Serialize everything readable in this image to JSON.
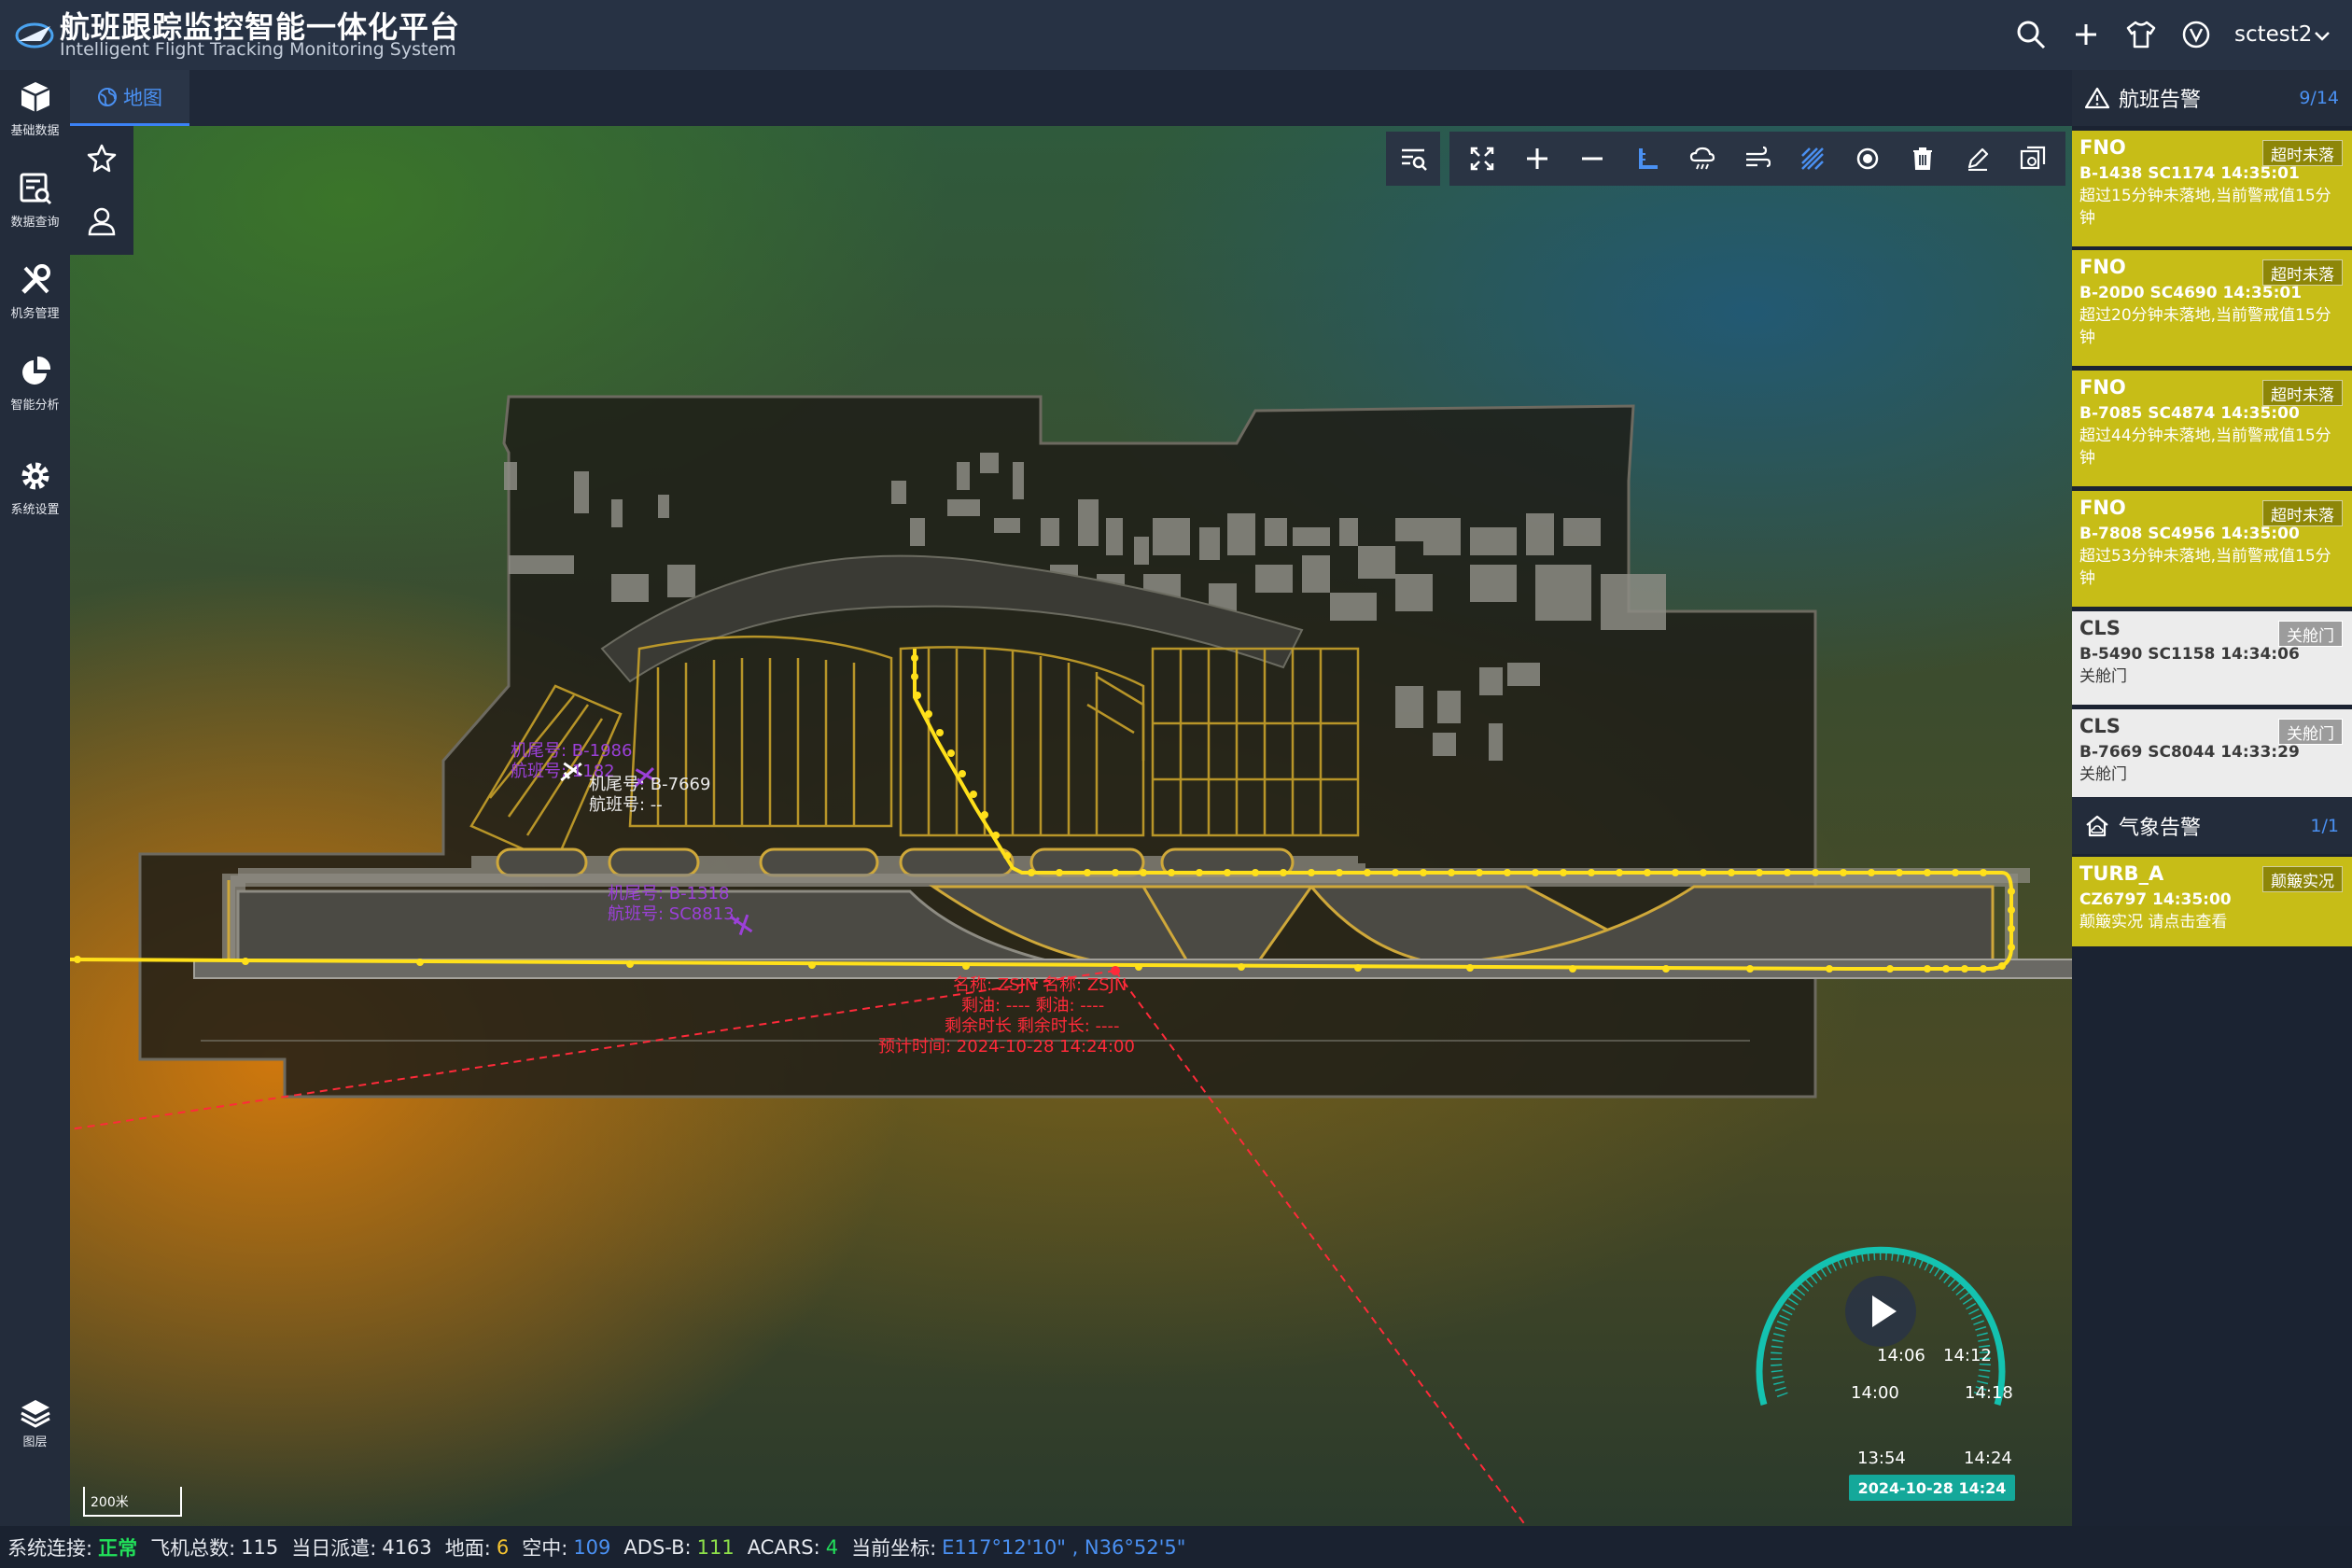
{
  "app": {
    "title": "航班跟踪监控智能一体化平台",
    "subtitle": "Intelligent Flight Tracking Monitoring System",
    "user": "sctest2"
  },
  "header_icons": [
    "search-icon",
    "plus-icon",
    "shirt-icon",
    "v-circle-icon",
    "chevron-down-icon"
  ],
  "nav": [
    {
      "label": "基础数据",
      "icon": "cube-icon"
    },
    {
      "label": "数据查询",
      "icon": "data-query-icon"
    },
    {
      "label": "机务管理",
      "icon": "tools-icon"
    },
    {
      "label": "智能分析",
      "icon": "pie-chart-icon"
    },
    {
      "label": "系统设置",
      "icon": "gear-icon"
    }
  ],
  "tabs": [
    {
      "label": "地图",
      "icon": "globe-icon"
    }
  ],
  "quick_buttons": [
    "star-icon",
    "user-icon"
  ],
  "layers": {
    "label": "图层"
  },
  "scale": {
    "label": "200米"
  },
  "toolbar": [
    "fullscreen-icon",
    "zoom-in-icon",
    "zoom-out-icon",
    "measure-icon",
    "weather-icon",
    "wind-icon",
    "hatch-icon",
    "record-icon",
    "delete-icon",
    "edit-icon",
    "screenshot-icon"
  ],
  "map_labels": {
    "ac1": {
      "tail": "机尾号: B-1986",
      "flight": "航班号: 1182"
    },
    "ac2": {
      "tail": "机尾号: B-7669",
      "flight": "航班号: --"
    },
    "ac3": {
      "tail": "机尾号: B-1318",
      "flight": "航班号: SC8813"
    },
    "wx": {
      "line1": "名称: ZSJN 名称: ZSJN",
      "line2": "剩油: ---- 剩油: ----",
      "line3": "剩余时长 剩余时长: ----",
      "line4": "预计时间: 2024-10-28 14:24:00"
    }
  },
  "playback": {
    "ticks": [
      "13:54",
      "14:00",
      "14:06",
      "14:12",
      "14:18",
      "14:24"
    ],
    "date": "2024-10-28 14:24"
  },
  "flight_alerts": {
    "title": "航班告警",
    "count": "9/14",
    "items": [
      {
        "code": "FNO",
        "badge": "超时未落",
        "line2": "B-1438  SC1174  14:35:01",
        "desc": "超过15分钟未落地,当前警戒值15分钟",
        "style": "yellow"
      },
      {
        "code": "FNO",
        "badge": "超时未落",
        "line2": "B-20D0  SC4690  14:35:01",
        "desc": "超过20分钟未落地,当前警戒值15分钟",
        "style": "yellow"
      },
      {
        "code": "FNO",
        "badge": "超时未落",
        "line2": "B-7085  SC4874  14:35:00",
        "desc": "超过44分钟未落地,当前警戒值15分钟",
        "style": "yellow"
      },
      {
        "code": "FNO",
        "badge": "超时未落",
        "line2": "B-7808  SC4956  14:35:00",
        "desc": "超过53分钟未落地,当前警戒值15分钟",
        "style": "yellow"
      },
      {
        "code": "CLS",
        "badge": "关舱门",
        "line2": "B-5490  SC1158  14:34:06",
        "desc": "关舱门",
        "style": "white"
      },
      {
        "code": "CLS",
        "badge": "关舱门",
        "line2": "B-7669  SC8044  14:33:29",
        "desc": "关舱门",
        "style": "white"
      }
    ]
  },
  "weather_alerts": {
    "title": "气象告警",
    "count": "1/1",
    "items": [
      {
        "code": "TURB_A",
        "badge": "颠簸实况",
        "line2": "CZ6797  14:35:00",
        "desc": "颠簸实况 请点击查看"
      }
    ]
  },
  "status": {
    "conn_label": "系统连接:",
    "conn_value": "正常",
    "total_label": "飞机总数:",
    "total_value": "115",
    "dispatch_label": "当日派遣:",
    "dispatch_value": "4163",
    "ground_label": "地面:",
    "ground_value": "6",
    "air_label": "空中:",
    "air_value": "109",
    "adsb_label": "ADS-B:",
    "adsb_value": "111",
    "acars_label": "ACARS:",
    "acars_value": "4",
    "coord_label": "当前坐标:",
    "coord_value": "E117°12'10\" , N36°52'5\"",
    "colors": {
      "ok": "#22e05a",
      "ground": "#f6c431",
      "air": "#4a90f2",
      "adsb": "#8ee04a",
      "acars": "#22e05a",
      "coord": "#4a90f2"
    }
  }
}
